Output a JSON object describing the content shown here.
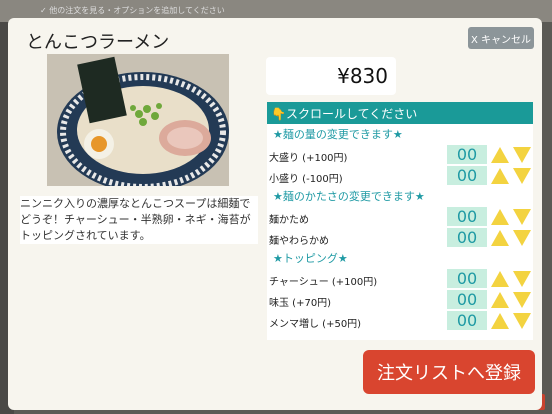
{
  "background": {
    "banner_text": "✓ 他の注文を見る・オプションを追加してください"
  },
  "modal": {
    "title": "とんこつラーメン",
    "cancel_label": "X キャンセル",
    "price": "¥830",
    "description": "ニンニク入りの濃厚なとんこつスープは細麺でどうぞ！チャーシュー・半熟卵・ネギ・海苔がトッピングされています。",
    "scroll_hint": "👇スクロールしてください",
    "sections": [
      {
        "title": "★麺の量の変更できます★",
        "items": [
          {
            "label": "大盛り (+100円)",
            "qty": "00"
          },
          {
            "label": "小盛り (-100円)",
            "qty": "00"
          }
        ]
      },
      {
        "title": "★麺のかたさの変更できます★",
        "items": [
          {
            "label": "麺かため",
            "qty": "00"
          },
          {
            "label": "麺やわらかめ",
            "qty": "00"
          }
        ]
      },
      {
        "title": "★トッピング★",
        "items": [
          {
            "label": "チャーシュー (+100円)",
            "qty": "00"
          },
          {
            "label": "味玉 (+70円)",
            "qty": "00"
          },
          {
            "label": "メンマ増し (+50円)",
            "qty": "00"
          }
        ]
      }
    ],
    "submit_label": "注文リストへ登録"
  },
  "colors": {
    "accent": "#1a9a98",
    "submit": "#d9452f",
    "triangle": "#f3d340"
  }
}
